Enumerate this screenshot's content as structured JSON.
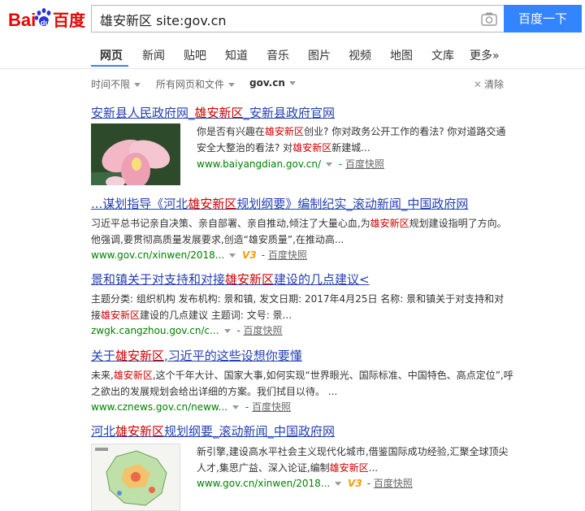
{
  "brand": {
    "logo_text_left": "Bai",
    "logo_text_mid": "du",
    "logo_text_right": "百度"
  },
  "search": {
    "query": "雄安新区 site:gov.cn",
    "button": "百度一下"
  },
  "tabs": [
    {
      "label": "网页"
    },
    {
      "label": "新闻"
    },
    {
      "label": "贴吧"
    },
    {
      "label": "知道"
    },
    {
      "label": "音乐"
    },
    {
      "label": "图片"
    },
    {
      "label": "视频"
    },
    {
      "label": "地图"
    },
    {
      "label": "文库"
    },
    {
      "label": "更多»"
    }
  ],
  "filters": {
    "time": "时间不限",
    "type": "所有网页和文件",
    "site": "gov.cn",
    "clear": "清除"
  },
  "results": [
    {
      "title_a": "安新县人民政府网_",
      "title_em": "雄安新区",
      "title_b": "_安新县政府官网",
      "abs": [
        {
          "t": "你是否有兴趣在"
        },
        {
          "em": "雄安新区"
        },
        {
          "t": "创业? 你对政务公开工作的看法? 你对道路交通安全大整治的看法? 对"
        },
        {
          "em": "雄安新区"
        },
        {
          "t": "新建城..."
        }
      ],
      "url": "www.baiyangdian.gov.cn/",
      "snap": "百度快照"
    },
    {
      "title_a": "...谋划指导《河北",
      "title_em": "雄安新区",
      "title_b": "规划纲要》编制纪实_滚动新闻_中国政府网",
      "abs_a": "习近平总书记亲自决策、亲自部署、亲自推动,倾注了大量心血,为",
      "abs_em": "雄安新区",
      "abs_b": "规划建设指明了方向。他强调,要贯彻高质量发展要求,创造“雄安质量”,在推动高...",
      "url": "www.gov.cn/xinwen/2018...",
      "v": "V3",
      "snap": "百度快照"
    },
    {
      "title_a": "景和镇关于对支持和对接",
      "title_em": "雄安新区",
      "title_b": "建设的几点建议<",
      "abs_a": "主题分类: 组织机构 发布机构: 景和镇, 发文日期: 2017年4月25日 名称: 景和镇关于对支持和对接",
      "abs_em": "雄安新区",
      "abs_b": "建设的几点建议 主题词: 文号: 景...",
      "url": "zwgk.cangzhou.gov.cn/c...",
      "snap": "百度快照"
    },
    {
      "title_a": "关于",
      "title_em": "雄安新区",
      "title_b": ",习近平的这些设想你要懂",
      "abs_a": "未来,",
      "abs_em": "雄安新区",
      "abs_b": ",这个千年大计、国家大事,如何实现“世界眼光、国际标准、中国特色、高点定位”,呼之欲出的发展规划会给出详细的方案。我们拭目以待。 ...",
      "url": "www.cznews.gov.cn/neww...",
      "snap": "百度快照"
    },
    {
      "title_a": "河北",
      "title_em": "雄安新区",
      "title_b": "规划纲要_滚动新闻_中国政府网",
      "abs_a": "新引擎,建设高水平社会主义现代化城市,借鉴国际成功经验,汇聚全球顶尖人才,集思广益、深入论证,编制",
      "abs_em": "雄安新区",
      "abs_b": "...",
      "url": "www.gov.cn/xinwen/2018...",
      "v": "V3",
      "snap": "百度快照"
    }
  ]
}
